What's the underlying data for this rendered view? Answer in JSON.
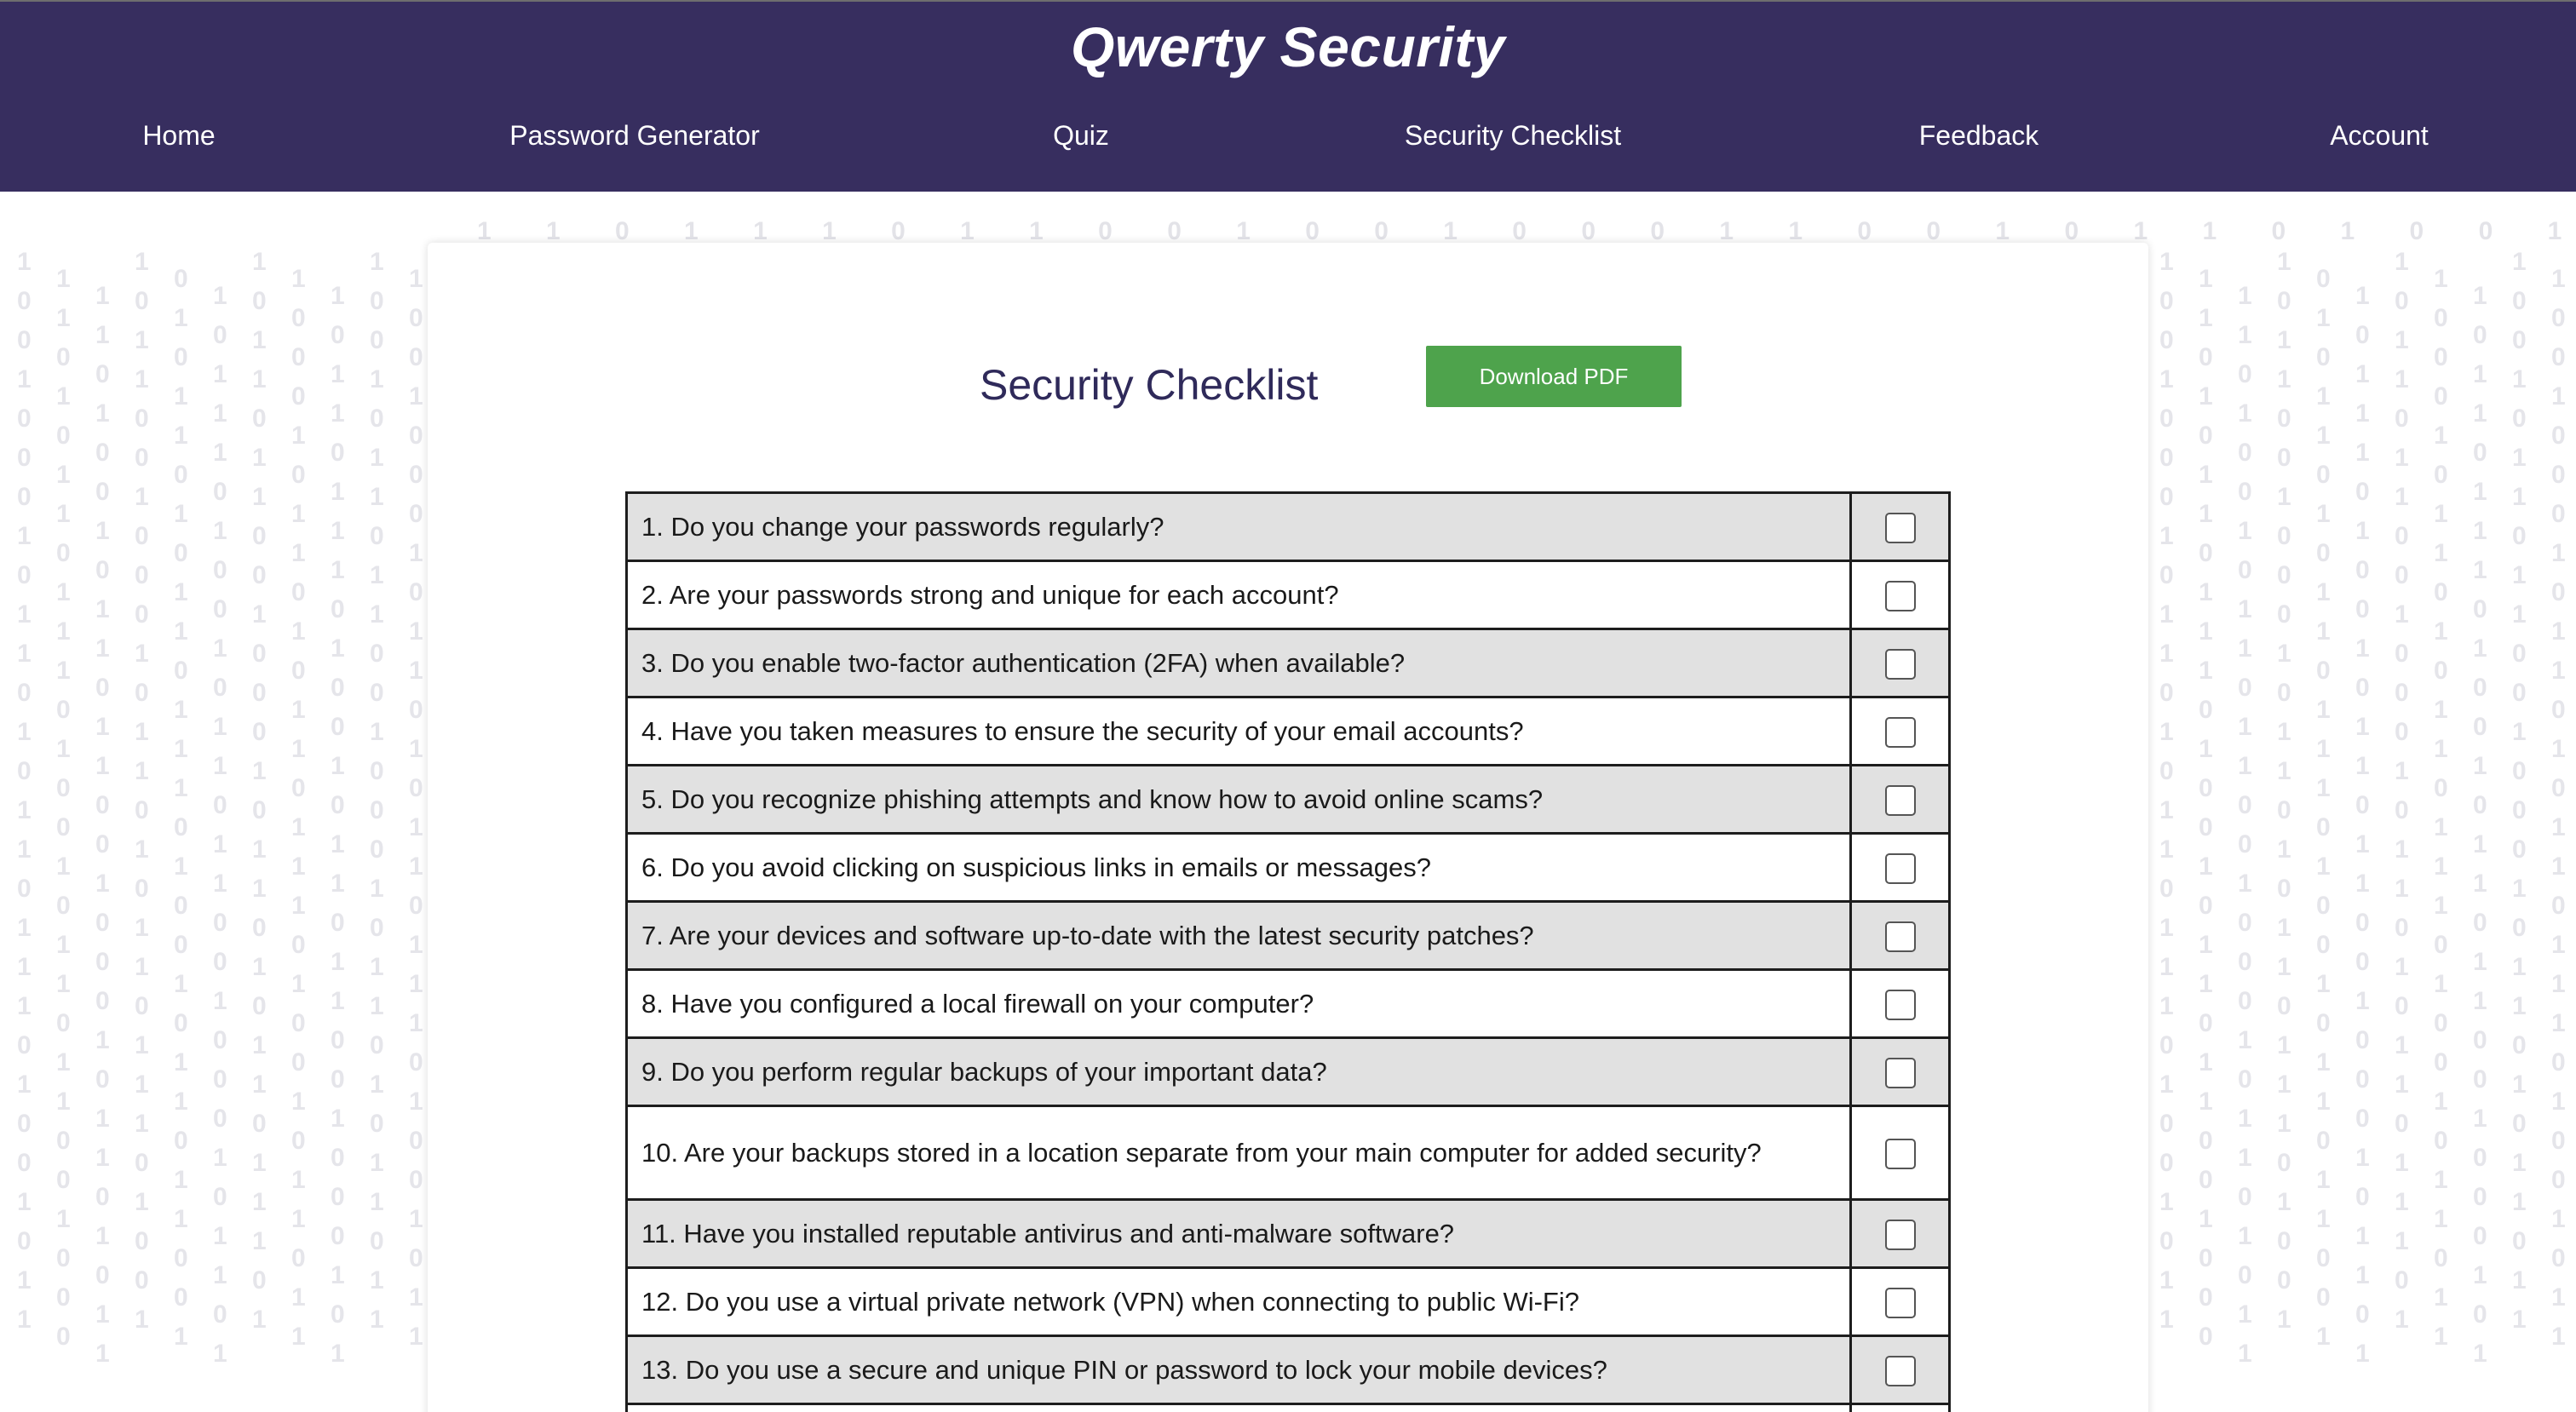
{
  "header": {
    "brand": "Qwerty Security",
    "nav": [
      {
        "label": "Home"
      },
      {
        "label": "Password Generator"
      },
      {
        "label": "Quiz"
      },
      {
        "label": "Security Checklist"
      },
      {
        "label": "Feedback"
      },
      {
        "label": "Account"
      }
    ]
  },
  "colors": {
    "header_bg": "#372e5f",
    "title_text": "#2f2a5a",
    "button_bg": "#4ea34c",
    "row_shade": "#e1e1e1"
  },
  "main": {
    "title": "Security Checklist",
    "download_label": "Download PDF",
    "items": [
      {
        "text": "1. Do you change your passwords regularly?",
        "checked": false
      },
      {
        "text": "2. Are your passwords strong and unique for each account?",
        "checked": false
      },
      {
        "text": "3. Do you enable two-factor authentication (2FA) when available?",
        "checked": false
      },
      {
        "text": "4. Have you taken measures to ensure the security of your email accounts?",
        "checked": false
      },
      {
        "text": "5. Do you recognize phishing attempts and know how to avoid online scams?",
        "checked": false
      },
      {
        "text": "6. Do you avoid clicking on suspicious links in emails or messages?",
        "checked": false
      },
      {
        "text": "7. Are your devices and software up-to-date with the latest security patches?",
        "checked": false
      },
      {
        "text": "8. Have you configured a local firewall on your computer?",
        "checked": false
      },
      {
        "text": "9. Do you perform regular backups of your important data?",
        "checked": false
      },
      {
        "text": "10. Are your backups stored in a location separate from your main computer for added security?",
        "checked": false
      },
      {
        "text": "11. Have you installed reputable antivirus and anti-malware software?",
        "checked": false
      },
      {
        "text": "12. Do you use a virtual private network (VPN) when connecting to public Wi-Fi?",
        "checked": false
      },
      {
        "text": "13. Do you use a secure and unique PIN or password to lock your mobile devices?",
        "checked": false
      },
      {
        "text": "",
        "checked": false
      }
    ]
  }
}
